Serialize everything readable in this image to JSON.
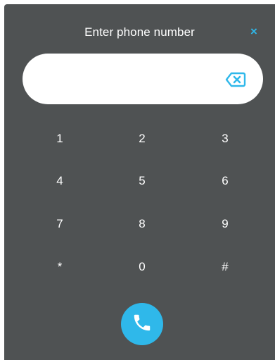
{
  "dialog": {
    "title": "Enter phone number",
    "close_label": "×"
  },
  "input": {
    "value": "",
    "placeholder": ""
  },
  "keypad": {
    "keys": [
      "1",
      "2",
      "3",
      "4",
      "5",
      "6",
      "7",
      "8",
      "9",
      "*",
      "0",
      "#"
    ]
  },
  "icons": {
    "close": "close-icon",
    "backspace": "backspace-icon",
    "call": "phone-icon"
  },
  "colors": {
    "accent": "#2fb8ea",
    "panel": "#4f5253",
    "text": "#ffffff"
  }
}
